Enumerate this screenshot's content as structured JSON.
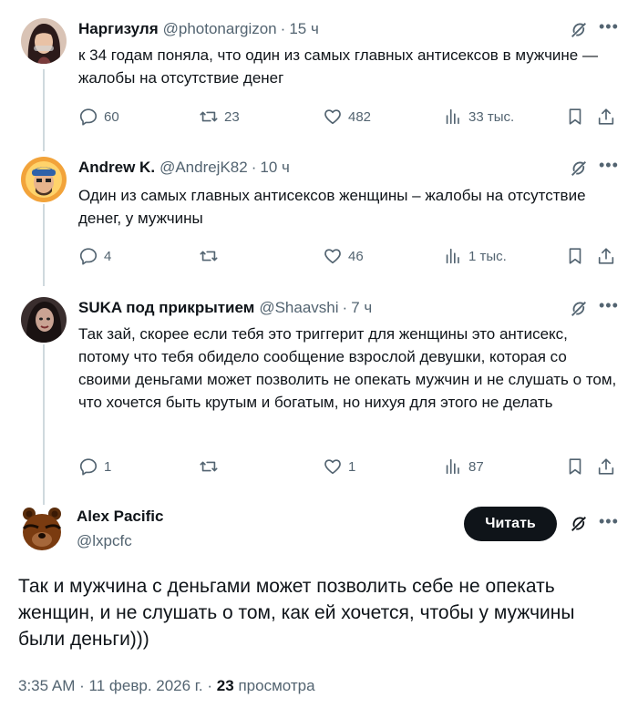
{
  "tweets": [
    {
      "name": "Наргизуля",
      "handle": "@photonargizon",
      "time": "15 ч",
      "text": "к 34 годам поняла, что один из самых главных антисексов в мужчине — жалобы на отсутствие денег",
      "replies": "60",
      "retweets": "23",
      "likes": "482",
      "views": "33 тыс."
    },
    {
      "name": "Andrew K.",
      "handle": "@AndrejK82",
      "time": "10 ч",
      "text": "Один из самых главных антисексов женщины – жалобы на отсутствие денег, у мужчины",
      "replies": "4",
      "retweets": "",
      "likes": "46",
      "views": "1 тыс."
    },
    {
      "name": "SUKA под прикрытием",
      "handle": "@Shaavshi",
      "time": "7 ч",
      "text": "Так зай, скорее если тебя это триггерит для женщины это антисекс, потому что тебя обидело сообщение взрослой девушки, которая со своими деньгами может позволить не опекать мужчин и не слушать о том, что хочется быть крутым и богатым, но нихуя для этого не делать",
      "replies": "1",
      "retweets": "",
      "likes": "1",
      "views": "87"
    }
  ],
  "main": {
    "name": "Alex Pacific",
    "handle": "@lxpcfc",
    "follow_label": "Читать",
    "text": "Так и мужчина с деньгами может позволить себе не опекать женщин, и не слушать о том, как ей хочется, чтобы у мужчины были деньги)))",
    "time": "3:35 AM",
    "date": "11 февр. 2026 г.",
    "views_count": "23",
    "views_label": "просмотра"
  },
  "separator": "·",
  "colors": {
    "text": "#0f1419",
    "muted": "#536471",
    "line": "#cfd9de",
    "button": "#0f1419"
  }
}
